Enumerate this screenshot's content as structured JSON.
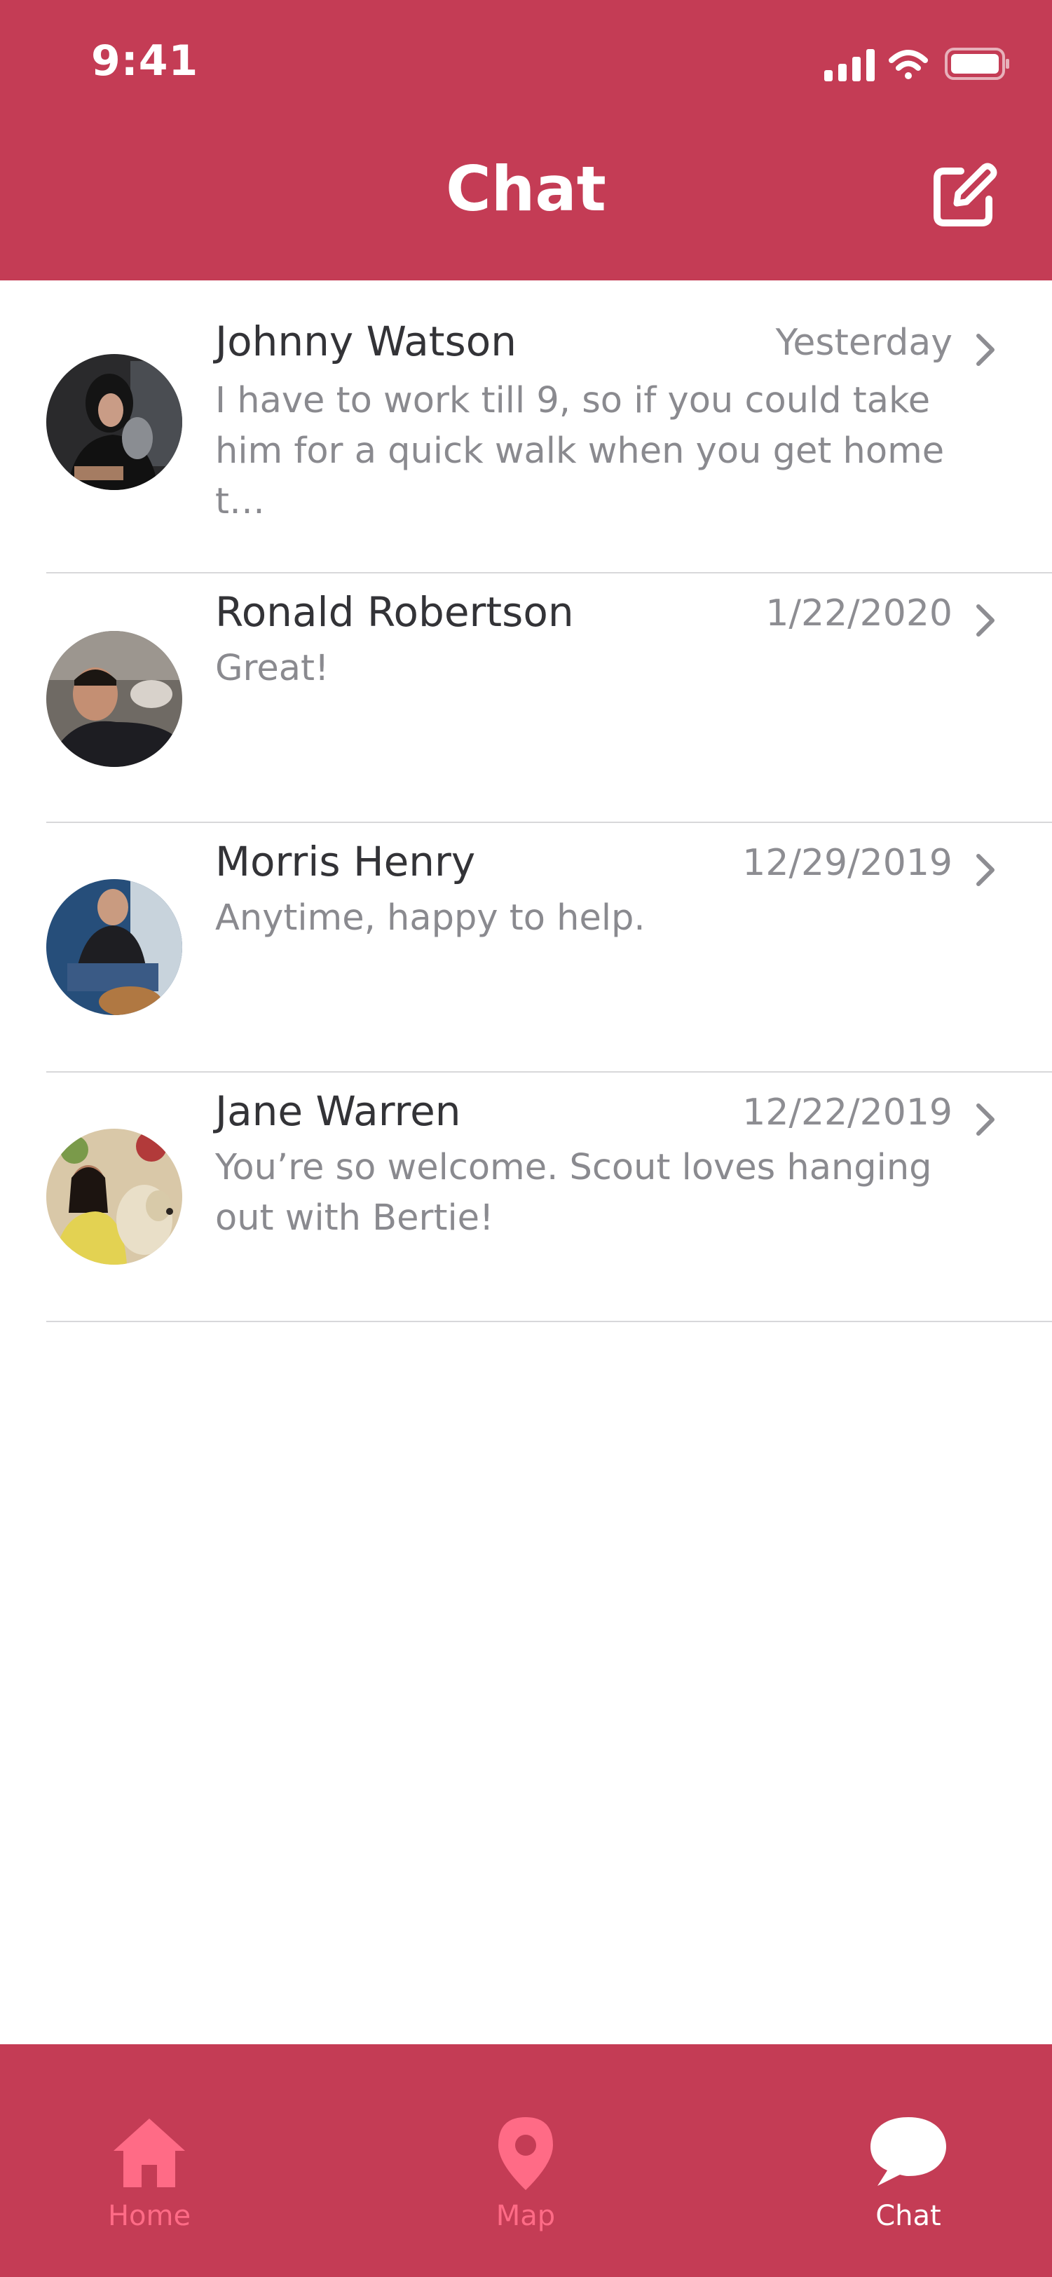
{
  "status_bar": {
    "time": "9:41"
  },
  "header": {
    "title": "Chat",
    "compose_icon": "compose-icon",
    "background_color": "#c43c55"
  },
  "chats": [
    {
      "name": "Johnny Watson",
      "date": "Yesterday",
      "message": "I have to work till 9, so if you could take him for a quick walk when you get home t…"
    },
    {
      "name": "Ronald Robertson",
      "date": "1/22/2020",
      "message": "Great!"
    },
    {
      "name": "Morris Henry",
      "date": "12/29/2019",
      "message": "Anytime, happy to help."
    },
    {
      "name": "Jane Warren",
      "date": "12/22/2019",
      "message": "You’re so welcome. Scout loves hanging out with Bertie!"
    }
  ],
  "tabbar": {
    "tabs": [
      {
        "label": "Home",
        "icon": "home-icon",
        "active": false
      },
      {
        "label": "Map",
        "icon": "map-pin-icon",
        "active": false
      },
      {
        "label": "Chat",
        "icon": "chat-bubble-icon",
        "active": true
      }
    ],
    "active_color": "#ffffff",
    "inactive_color": "#ff6b86"
  }
}
